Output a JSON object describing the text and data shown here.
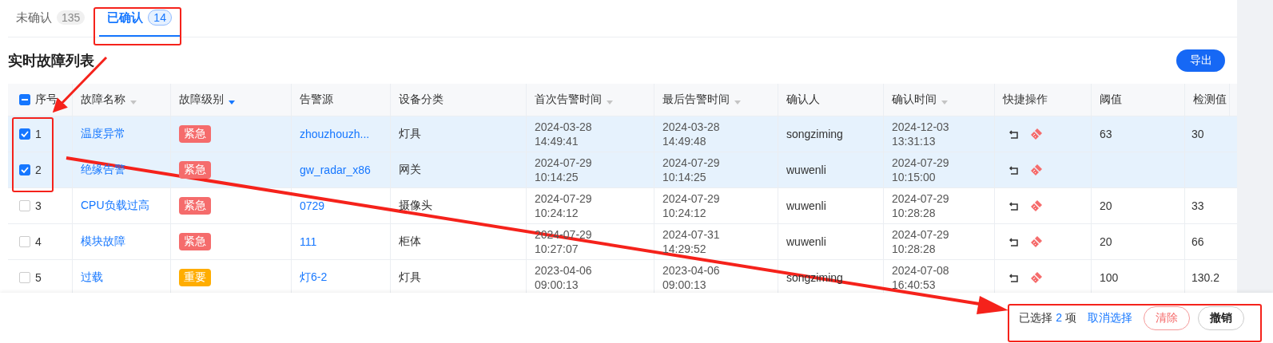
{
  "tabs": [
    {
      "label": "未确认",
      "count": "135",
      "selected": false
    },
    {
      "label": "已确认",
      "count": "14",
      "selected": true
    }
  ],
  "title": "实时故障列表",
  "export_button": "导出",
  "table": {
    "select_all_partial": true,
    "columns": [
      {
        "label": "序号"
      },
      {
        "label": "故障名称",
        "sortable": true,
        "sorted": false
      },
      {
        "label": "故障级别",
        "sortable": true,
        "sorted": true
      },
      {
        "label": "告警源"
      },
      {
        "label": "设备分类"
      },
      {
        "label": "首次告警时间",
        "sortable": true,
        "sorted": false
      },
      {
        "label": "最后告警时间",
        "sortable": true,
        "sorted": false
      },
      {
        "label": "确认人"
      },
      {
        "label": "确认时间",
        "sortable": true,
        "sorted": false
      },
      {
        "label": "快捷操作"
      },
      {
        "label": "阈值"
      },
      {
        "label": "检测值"
      }
    ],
    "rows": [
      {
        "seq": "1",
        "checked": true,
        "name": "温度异常",
        "level": {
          "label": "紧急",
          "kind": "urgent"
        },
        "source": "zhouzhouzh...",
        "category": "灯具",
        "first_time": "2024-03-28 14:49:41",
        "last_time": "2024-03-28 14:49:48",
        "confirmer": "songziming",
        "confirm_time": "2024-12-03 13:31:13",
        "threshold": "63",
        "measured": "30"
      },
      {
        "seq": "2",
        "checked": true,
        "name": "绝缘告警",
        "level": {
          "label": "紧急",
          "kind": "urgent"
        },
        "source": "gw_radar_x86",
        "category": "网关",
        "first_time": "2024-07-29 10:14:25",
        "last_time": "2024-07-29 10:14:25",
        "confirmer": "wuwenli",
        "confirm_time": "2024-07-29 10:15:00"
      },
      {
        "seq": "3",
        "checked": false,
        "name": "CPU负载过高",
        "level": {
          "label": "紧急",
          "kind": "urgent"
        },
        "source": "0729",
        "category": "摄像头",
        "first_time": "2024-07-29 10:24:12",
        "last_time": "2024-07-29 10:24:12",
        "confirmer": "wuwenli",
        "confirm_time": "2024-07-29 10:28:28",
        "threshold": "20",
        "measured": "33"
      },
      {
        "seq": "4",
        "checked": false,
        "name": "模块故障",
        "level": {
          "label": "紧急",
          "kind": "urgent"
        },
        "source": "111",
        "category": "柜体",
        "first_time": "2024-07-29 10:27:07",
        "last_time": "2024-07-31 14:29:52",
        "confirmer": "wuwenli",
        "confirm_time": "2024-07-29 10:28:28",
        "threshold": "20",
        "measured": "66"
      },
      {
        "seq": "5",
        "checked": false,
        "name": "过载",
        "level": {
          "label": "重要",
          "kind": "important"
        },
        "source": "灯6-2",
        "category": "灯具",
        "first_time": "2023-04-06 09:00:13",
        "last_time": "2023-04-06 09:00:13",
        "confirmer": "songziming",
        "confirm_time": "2024-07-08 16:40:53",
        "threshold": "100",
        "measured": "130.2"
      }
    ]
  },
  "footer": {
    "selected_prefix": "已选择",
    "selected_count": "2",
    "selected_suffix": "项",
    "cancel_link": "取消选择",
    "buttons": [
      {
        "label": "清除",
        "kind": "danger"
      },
      {
        "label": "撤销",
        "kind": "default"
      }
    ]
  }
}
